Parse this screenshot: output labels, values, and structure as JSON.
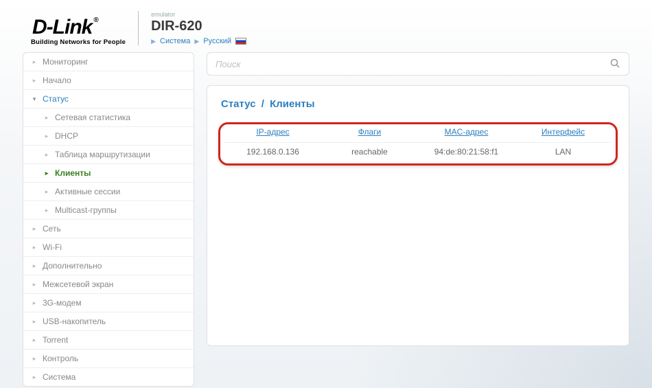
{
  "header": {
    "logo_main": "D-Link",
    "logo_reg": "®",
    "logo_sub": "Building Networks for People",
    "emulator": "emulator",
    "product": "DIR-620",
    "nav_system": "Система",
    "nav_lang": "Русский"
  },
  "sidebar": {
    "items": [
      {
        "label": "Мониторинг"
      },
      {
        "label": "Начало"
      },
      {
        "label": "Статус",
        "active": true
      },
      {
        "label": "Сетевая статистика",
        "sub": true
      },
      {
        "label": "DHCP",
        "sub": true
      },
      {
        "label": "Таблица маршрутизации",
        "sub": true
      },
      {
        "label": "Клиенты",
        "sub": true,
        "selected": true
      },
      {
        "label": "Активные сессии",
        "sub": true
      },
      {
        "label": "Multicast-группы",
        "sub": true
      },
      {
        "label": "Сеть"
      },
      {
        "label": "Wi-Fi"
      },
      {
        "label": "Дополнительно"
      },
      {
        "label": "Межсетевой экран"
      },
      {
        "label": "3G-модем"
      },
      {
        "label": "USB-накопитель"
      },
      {
        "label": "Torrent"
      },
      {
        "label": "Контроль"
      },
      {
        "label": "Система"
      }
    ]
  },
  "search": {
    "placeholder": "Поиск"
  },
  "breadcrumb": {
    "section": "Статус",
    "page": "Клиенты",
    "sep": "/"
  },
  "table": {
    "headers": {
      "ip": "IP-адрес",
      "flags": "Флаги",
      "mac": "MAC-адрес",
      "iface": "Интерфейс"
    },
    "row": {
      "ip": "192.168.0.136",
      "flags": "reachable",
      "mac": "94:de:80:21:58:f1",
      "iface": "LAN"
    }
  }
}
